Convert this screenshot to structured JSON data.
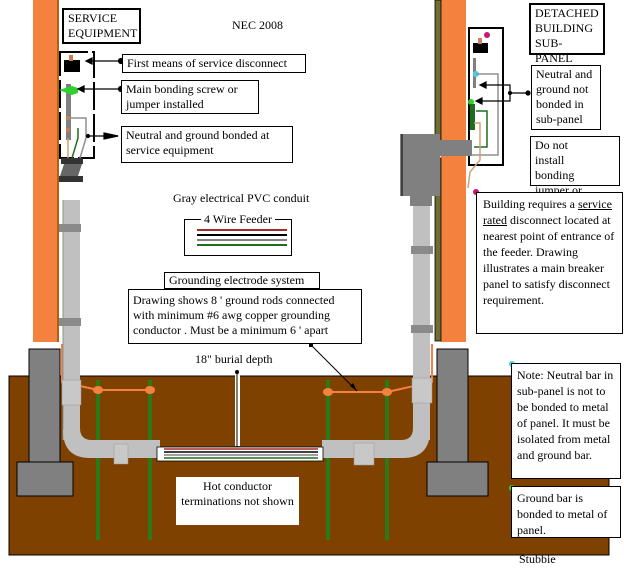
{
  "title": "NEC 2008",
  "credit": "Stubbie",
  "colors": {
    "wall": "#f5813f",
    "soil": "#7f4100",
    "conduit": "#c0c0c0",
    "footing": "#808080",
    "ground_rod": "#2a7a1a",
    "electrode_conductor": "#f5813f",
    "neutral_marker": "#3fd6e8",
    "ground_marker": "#2ed12e",
    "disconnect_marker": "#c8186e",
    "wire_red": "#a52a2a",
    "wire_black": "#000000",
    "wire_gray": "#808080",
    "wire_green": "#1e6e1e"
  },
  "service_equipment": {
    "heading_line1": "SERVICE",
    "heading_line2": "EQUIPMENT",
    "callouts": [
      "First means of service disconnect",
      "Main bonding screw or jumper installed",
      "Neutral and ground bonded at service equipment"
    ]
  },
  "sub_panel": {
    "heading_line1": "DETACHED",
    "heading_line2": "BUILDING",
    "heading_line3": "SUB-PANEL",
    "not_bonded": "Neutral and ground not bonded in sub-panel",
    "no_jumper": "Do not install bonding jumper or screw"
  },
  "conduit_label": "Gray electrical PVC conduit",
  "feeder": {
    "label": "4 Wire Feeder",
    "wires": [
      "red",
      "black",
      "gray",
      "green"
    ]
  },
  "grounding": {
    "heading": "Grounding electrode system",
    "description": "Drawing shows 8 ' ground rods connected with minimum #6 awg copper grounding conductor .  Must be a minimum 6 ' apart"
  },
  "burial_depth": "18\" burial depth",
  "hot_note": "Hot conductor terminations not shown",
  "notes": {
    "service_rated": {
      "before": "Building requires a ",
      "underlined": "service rated",
      "after": " disconnect located at nearest point of entrance of the feeder. Drawing illustrates a main breaker panel to satisfy disconnect requirement."
    },
    "neutral_bar": "Note: Neutral bar in sub-panel is not to be bonded to metal of panel. It must be isolated from metal and ground bar.",
    "ground_bar": "Ground bar is bonded to metal of panel."
  }
}
